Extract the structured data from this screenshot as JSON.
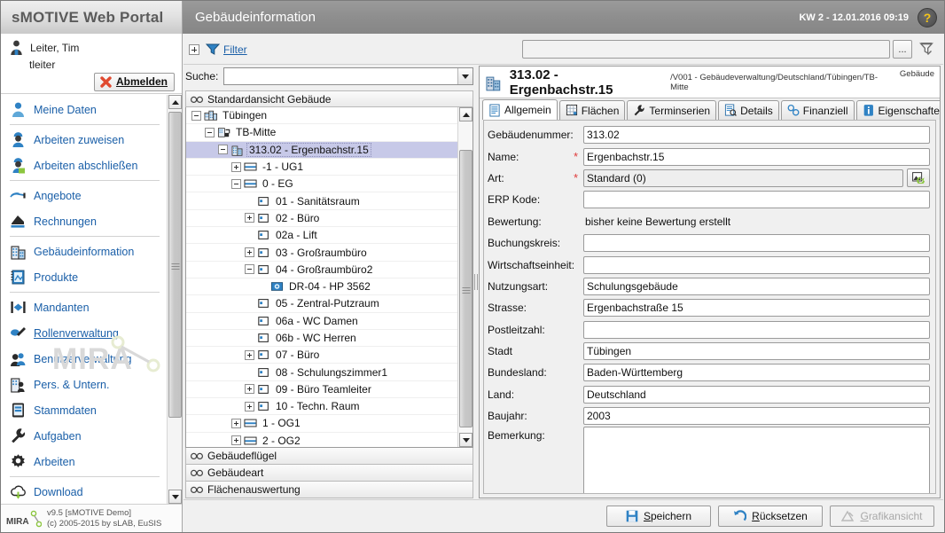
{
  "header": {
    "brand": "sMOTIVE Web Portal",
    "module_title": "Gebäudeinformation",
    "kw_datetime": "KW 2 - 12.01.2016 09:19",
    "help_label": "?"
  },
  "user": {
    "display_name": "Leiter, Tim",
    "login": "tleiter",
    "logout_label": "Abmelden"
  },
  "sidebar": {
    "items": [
      {
        "label": "Meine Daten",
        "icon": "user-icon",
        "sep_after": true
      },
      {
        "label": "Arbeiten zuweisen",
        "icon": "worker-assign-icon"
      },
      {
        "label": "Arbeiten abschließen",
        "icon": "worker-complete-icon",
        "sep_after": true
      },
      {
        "label": "Angebote",
        "icon": "offer-icon"
      },
      {
        "label": "Rechnungen",
        "icon": "invoice-icon",
        "sep_after": true
      },
      {
        "label": "Gebäudeinformation",
        "icon": "building-icon"
      },
      {
        "label": "Produkte",
        "icon": "product-icon",
        "sep_after": true
      },
      {
        "label": "Mandanten",
        "icon": "clients-icon"
      },
      {
        "label": "Rollenverwaltung",
        "icon": "roles-icon",
        "underline": true
      },
      {
        "label": "Benutzerverwaltung",
        "icon": "users-icon"
      },
      {
        "label": "Pers. & Untern.",
        "icon": "person-company-icon"
      },
      {
        "label": "Stammdaten",
        "icon": "masterdata-icon"
      },
      {
        "label": "Aufgaben",
        "icon": "wrench-icon"
      },
      {
        "label": "Arbeiten",
        "icon": "gear-icon",
        "sep_after": true
      },
      {
        "label": "Download",
        "icon": "download-cloud-icon"
      }
    ],
    "watermark": "MIRA",
    "version_line1": "v9.5 [sMOTIVE Demo]",
    "version_line2": "(c) 2005-2015 by sLAB, EuSIS"
  },
  "filterbar": {
    "filter_label": "Filter",
    "filter_value": "",
    "more_label": "...",
    "funnel_icon": "funnel-clear-icon"
  },
  "tree_panel": {
    "search_label": "Suche:",
    "search_value": "",
    "accordion_title": "Standardansicht Gebäude",
    "footers": [
      "Gebäudeflügel",
      "Gebäudeart",
      "Flächenauswertung"
    ],
    "nodes": [
      {
        "label": "Tübingen",
        "indent": 1,
        "toggle": "minus",
        "icon": "city-icon",
        "selected": false
      },
      {
        "label": "TB-Mitte",
        "indent": 2,
        "toggle": "minus",
        "icon": "district-icon",
        "selected": false
      },
      {
        "label": "313.02 - Ergenbachstr.15",
        "indent": 3,
        "toggle": "minus",
        "icon": "building-icon",
        "selected": true
      },
      {
        "label": "-1 - UG1",
        "indent": 4,
        "toggle": "plus",
        "icon": "floor-icon",
        "selected": false
      },
      {
        "label": "0 - EG",
        "indent": 4,
        "toggle": "minus",
        "icon": "floor-icon",
        "selected": false
      },
      {
        "label": "01 - Sanitätsraum",
        "indent": 5,
        "toggle": "none",
        "icon": "room-icon",
        "selected": false
      },
      {
        "label": "02 - Büro",
        "indent": 5,
        "toggle": "plus",
        "icon": "room-icon",
        "selected": false
      },
      {
        "label": "02a - Lift",
        "indent": 5,
        "toggle": "none",
        "icon": "room-icon",
        "selected": false
      },
      {
        "label": "03 - Großraumbüro",
        "indent": 5,
        "toggle": "plus",
        "icon": "room-icon",
        "selected": false
      },
      {
        "label": "04 - Großraumbüro2",
        "indent": 5,
        "toggle": "minus",
        "icon": "room-icon",
        "selected": false
      },
      {
        "label": "DR-04 - HP 3562",
        "indent": 6,
        "toggle": "none",
        "icon": "device-icon",
        "selected": false
      },
      {
        "label": "05 - Zentral-Putzraum",
        "indent": 5,
        "toggle": "none",
        "icon": "room-icon",
        "selected": false
      },
      {
        "label": "06a - WC Damen",
        "indent": 5,
        "toggle": "none",
        "icon": "room-icon",
        "selected": false
      },
      {
        "label": "06b - WC Herren",
        "indent": 5,
        "toggle": "none",
        "icon": "room-icon",
        "selected": false
      },
      {
        "label": "07 - Büro",
        "indent": 5,
        "toggle": "plus",
        "icon": "room-icon",
        "selected": false
      },
      {
        "label": "08 - Schulungszimmer1",
        "indent": 5,
        "toggle": "none",
        "icon": "room-icon",
        "selected": false
      },
      {
        "label": "09 - Büro Teamleiter",
        "indent": 5,
        "toggle": "plus",
        "icon": "room-icon",
        "selected": false
      },
      {
        "label": "10 - Techn. Raum",
        "indent": 5,
        "toggle": "plus",
        "icon": "room-icon",
        "selected": false
      },
      {
        "label": "1 - OG1",
        "indent": 4,
        "toggle": "plus",
        "icon": "floor-icon",
        "selected": false
      },
      {
        "label": "2 - OG2",
        "indent": 4,
        "toggle": "plus",
        "icon": "floor-icon",
        "selected": false
      }
    ]
  },
  "detail": {
    "title": "313.02 - Ergenbachstr.15",
    "path": "/V001 - Gebäudeverwaltung/Deutschland/Tübingen/TB-Mitte",
    "type_label": "Gebäude",
    "tabs": [
      {
        "label": "Allgemein",
        "icon": "document-icon",
        "active": true
      },
      {
        "label": "Flächen",
        "icon": "grid-icon",
        "active": false
      },
      {
        "label": "Terminserien",
        "icon": "wrench-icon",
        "active": false
      },
      {
        "label": "Details",
        "icon": "detail-icon",
        "active": false
      },
      {
        "label": "Finanziell",
        "icon": "finance-icon",
        "active": false
      },
      {
        "label": "Eigenschaften",
        "icon": "info-icon",
        "active": false
      }
    ],
    "fields": [
      {
        "label": "Gebäudenummer:",
        "value": "313.02",
        "kind": "input",
        "required": false
      },
      {
        "label": "Name:",
        "value": "Ergenbachstr.15",
        "kind": "input",
        "required": true
      },
      {
        "label": "Art:",
        "value": "Standard (0)",
        "kind": "picker",
        "required": true
      },
      {
        "label": "ERP Kode:",
        "value": "",
        "kind": "input",
        "required": false
      },
      {
        "label": "Bewertung:",
        "value": "bisher keine Bewertung erstellt",
        "kind": "static",
        "required": false
      },
      {
        "label": "Buchungskreis:",
        "value": "",
        "kind": "input",
        "required": false
      },
      {
        "label": "Wirtschaftseinheit:",
        "value": "",
        "kind": "input",
        "required": false
      },
      {
        "label": "Nutzungsart:",
        "value": "Schulungsgebäude",
        "kind": "input",
        "required": false
      },
      {
        "label": "Strasse:",
        "value": "Ergenbachstraße 15",
        "kind": "input",
        "required": false
      },
      {
        "label": "Postleitzahl:",
        "value": "",
        "kind": "input",
        "required": false
      },
      {
        "label": "Stadt",
        "value": "Tübingen",
        "kind": "input",
        "required": false
      },
      {
        "label": "Bundesland:",
        "value": "Baden-Württemberg",
        "kind": "input",
        "required": false
      },
      {
        "label": "Land:",
        "value": "Deutschland",
        "kind": "input",
        "required": false
      },
      {
        "label": "Baujahr:",
        "value": "2003",
        "kind": "input",
        "required": false
      },
      {
        "label": "Bemerkung:",
        "value": "",
        "kind": "textarea",
        "required": false
      }
    ]
  },
  "bottombar": {
    "save_label": "Speichern",
    "reset_label": "Rücksetzen",
    "graphic_label": "Grafikansicht"
  },
  "colors": {
    "accent_link": "#1a5fa8",
    "selection": "#c7c9e8",
    "required": "#e03a3a",
    "header_gray": "#8e8e8e",
    "help_yellow": "#f5c518"
  }
}
